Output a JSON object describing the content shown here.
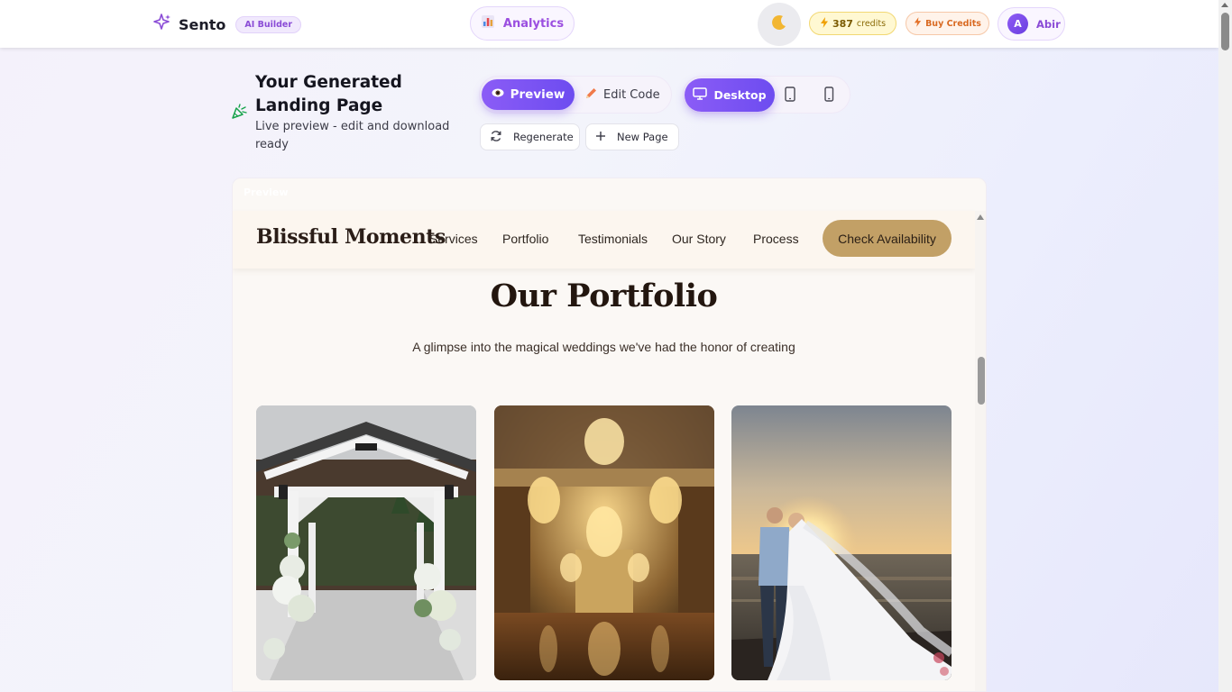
{
  "app": {
    "brand_name": "Sento",
    "brand_badge": "AI Builder",
    "analytics_label": "Analytics",
    "credits_value": "387",
    "credits_label": "credits",
    "buy_credits_label": "Buy Credits",
    "user_initial": "A",
    "user_name": "Abir"
  },
  "header": {
    "title": "Your Generated Landing Page",
    "subtitle": "Live preview - edit and download ready",
    "preview_label": "Preview",
    "edit_code_label": "Edit Code",
    "desktop_label": "Desktop",
    "regenerate_label": "Regenerate",
    "new_page_label": "New Page"
  },
  "preview": {
    "frame_label": "Preview",
    "site": {
      "logo": "Blissful Moments",
      "nav_links": [
        "Services",
        "Portfolio",
        "Testimonials",
        "Our Story",
        "Process"
      ],
      "cta": "Check Availability",
      "section_title": "Our Portfolio",
      "section_subtitle": "A glimpse into the magical weddings we've had the honor of creating"
    }
  },
  "icons": {
    "brand": "sparkle-icon",
    "analytics": "bar-chart-icon",
    "theme": "moon-icon",
    "credits": "lightning-icon",
    "buy": "lightning-icon",
    "generated": "party-popper-icon",
    "preview": "eye-icon",
    "edit": "pencil-icon",
    "desktop": "monitor-icon",
    "tablet": "tablet-icon",
    "mobile": "mobile-icon",
    "regenerate": "refresh-icon",
    "new_page": "plus-icon"
  },
  "colors": {
    "accent_purple": "#8b5cf6",
    "cta_gold": "#c2a066",
    "credits_yellow": "#fff8d2",
    "buy_orange": "#d96a22"
  }
}
